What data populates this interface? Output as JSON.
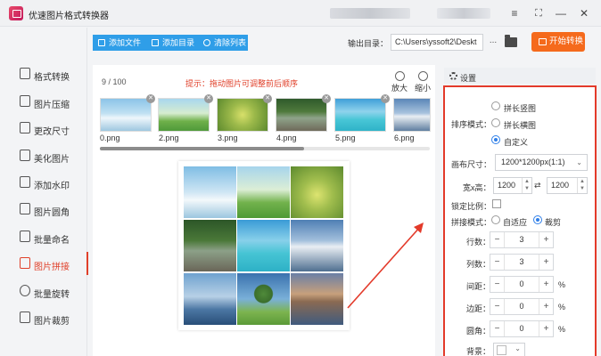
{
  "window": {
    "title": "优速图片格式转换器",
    "controls": [
      "≡",
      "⛶",
      "—",
      "✕"
    ]
  },
  "sidebar": {
    "items": [
      {
        "label": "格式转换",
        "icon": "format-convert-icon",
        "active": false
      },
      {
        "label": "图片压缩",
        "icon": "compress-icon",
        "active": false
      },
      {
        "label": "更改尺寸",
        "icon": "resize-icon",
        "active": false
      },
      {
        "label": "美化图片",
        "icon": "beautify-icon",
        "active": false
      },
      {
        "label": "添加水印",
        "icon": "watermark-icon",
        "active": false
      },
      {
        "label": "图片圆角",
        "icon": "rounded-corner-icon",
        "active": false
      },
      {
        "label": "批量命名",
        "icon": "rename-icon",
        "active": false
      },
      {
        "label": "图片拼接",
        "icon": "stitch-icon",
        "active": true
      },
      {
        "label": "批量旋转",
        "icon": "rotate-icon",
        "active": false
      },
      {
        "label": "图片裁剪",
        "icon": "crop-icon",
        "active": false
      }
    ]
  },
  "toolbar": {
    "add_file": "添加文件",
    "add_folder": "添加目录",
    "clear_list": "清除列表",
    "output_label": "输出目录：",
    "output_path": "C:\\Users\\yssoft2\\Deskt",
    "more": "...",
    "start": "开始转换"
  },
  "main": {
    "counter": "9 / 100",
    "hint": "提示：拖动图片可调整前后顺序",
    "zoom_in": "放大",
    "zoom_out": "缩小",
    "thumbnails": [
      "0.png",
      "2.png",
      "3.png",
      "4.png",
      "5.png",
      "6.png"
    ],
    "thumb_close": "✕",
    "scroll_fraction": 0.62
  },
  "settings": {
    "title": "设置",
    "sort_label": "排序模式：",
    "sort_options": [
      "拼长竖图",
      "拼长横图",
      "自定义"
    ],
    "sort_selected": "自定义",
    "canvas_label": "画布尺寸：",
    "canvas_value": "1200*1200px(1:1)",
    "wh_label": "宽x高：",
    "width": "1200",
    "height": "1200",
    "lock_label": "锁定比例：",
    "lock_checked": false,
    "stitch_label": "拼接模式：",
    "stitch_options": [
      "自适应",
      "裁剪"
    ],
    "stitch_selected": "裁剪",
    "rows_label": "行数：",
    "rows": "3",
    "cols_label": "列数：",
    "cols": "3",
    "spacing_label": "间距：",
    "spacing": "0",
    "margin_label": "边距：",
    "margin": "0",
    "radius_label": "圆角：",
    "radius": "0",
    "bg_label": "背景：",
    "unit_percent": "%",
    "minus": "−",
    "plus": "+",
    "dropdown_arrow": "⌄"
  },
  "colors": {
    "accent_blue": "#2f9ee8",
    "accent_orange": "#f56a1c",
    "highlight_red": "#e33a2a",
    "hint_red": "#e0402a"
  }
}
